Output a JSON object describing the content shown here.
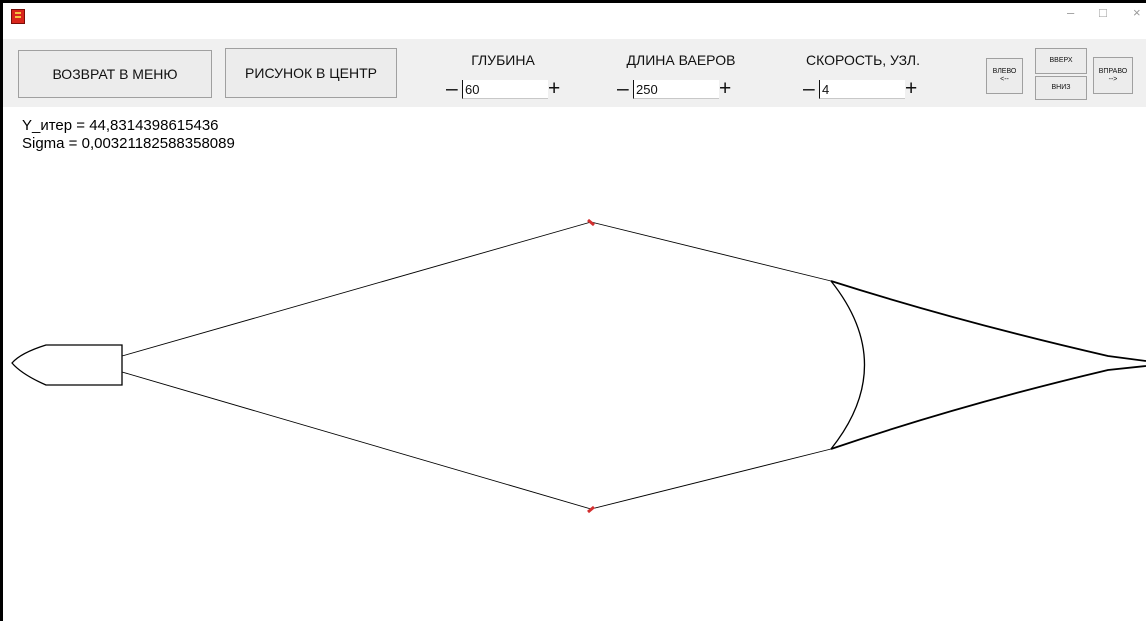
{
  "toolbar": {
    "menu_label": "ВОЗВРАТ В МЕНЮ",
    "center_label": "РИСУНОК В ЦЕНТР",
    "depth": {
      "label": "ГЛУБИНА",
      "value": "60",
      "minus": "–",
      "plus": "+"
    },
    "warp": {
      "label": "ДЛИНА ВАЕРОВ",
      "value": "250",
      "minus": "–",
      "plus": "+"
    },
    "speed": {
      "label": "СКОРОСТЬ, УЗЛ.",
      "value": "4",
      "minus": "–",
      "plus": "+"
    },
    "nav": {
      "left_line1": "ВЛЕВО",
      "left_line2": "<--",
      "up": "ВВЕРХ",
      "down": "ВНИЗ",
      "right_line1": "ВПРАВО",
      "right_line2": "-->"
    }
  },
  "window": {
    "min": "–",
    "max": "□",
    "close": "×"
  },
  "readouts": {
    "y_iter": "Y_итер = 44,8314398615436",
    "sigma": "Sigma = 0,00321182588358089"
  },
  "colors": {
    "door_marker": "#d32f2f",
    "line": "#000000",
    "toolbar_bg": "#f0f0f0"
  }
}
